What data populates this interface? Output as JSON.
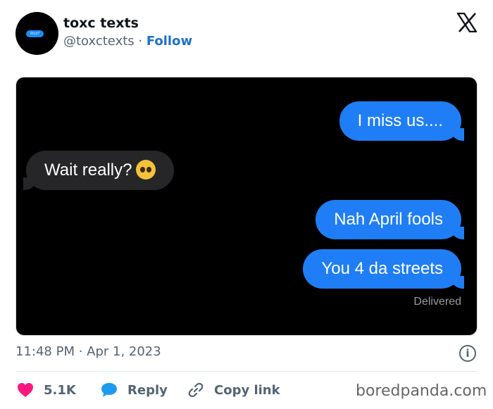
{
  "account": {
    "name": "toxc texts",
    "handle": "@toxctexts",
    "separator": " · ",
    "follow_label": "Follow",
    "avatar_text": "Wyd?"
  },
  "messages": [
    {
      "from": "me",
      "text": "I miss us...."
    },
    {
      "from": "them",
      "text": "Wait really?",
      "emoji": "pleading-face"
    },
    {
      "from": "me",
      "text": "Nah April fools"
    },
    {
      "from": "me",
      "text": "You 4 da streets"
    }
  ],
  "delivered_label": "Delivered",
  "timestamp": "11:48 PM · Apr 1, 2023",
  "actions": {
    "likes": "5.1K",
    "reply_label": "Reply",
    "copy_link_label": "Copy link"
  },
  "watermark": "boredpanda.com",
  "colors": {
    "outgoing_bubble": "#1f7ef5",
    "incoming_bubble": "#262628",
    "follow": "#1d72c7",
    "heart": "#f91880",
    "reply_icon": "#1d9bf0"
  },
  "icons": [
    "x-logo-icon",
    "info-icon",
    "heart-icon",
    "reply-bubble-icon",
    "link-icon",
    "pleading-face-emoji"
  ]
}
